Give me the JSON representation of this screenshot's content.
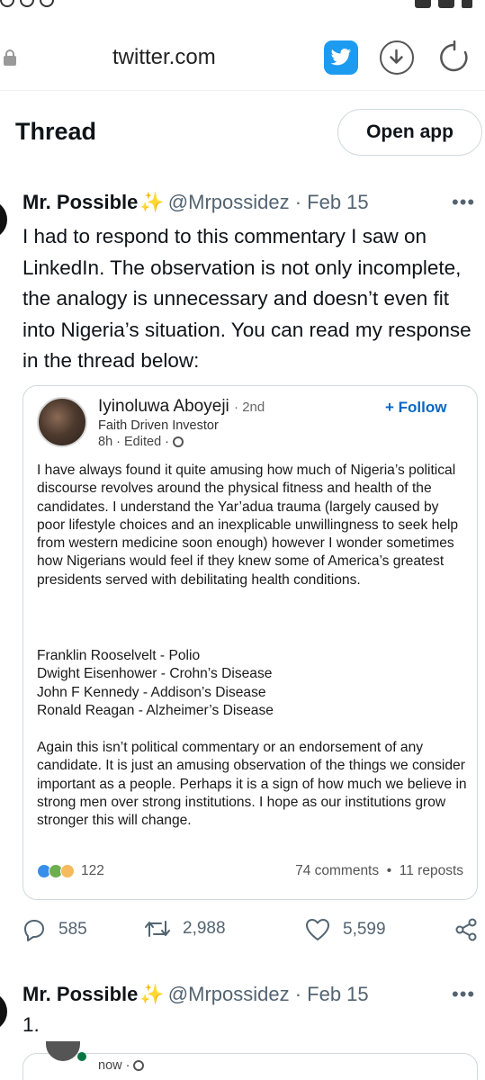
{
  "browser": {
    "url": "twitter.com"
  },
  "header": {
    "title": "Thread",
    "open_app_label": "Open app"
  },
  "tweet1": {
    "author": "Mr. Possible",
    "handle_date": "@Mrpossidez · Feb 15",
    "more": "•••",
    "text": "I had to respond to this commentary I saw on LinkedIn. The observation is not only incomplete, the analogy is unnecessary and doesn’t even fit into Nigeria’s situation. You can read my response in the thread below:",
    "card": {
      "name": "Iyinoluwa Aboyeji",
      "degree": "· 2nd",
      "headline": "Faith Driven Investor",
      "meta": "8h · Edited ·",
      "follow": "+ Follow",
      "paragraph1": "I have always found it quite amusing how much of Nigeria’s political discourse revolves around the physical fitness and health of the candidates. I understand the Yar’adua trauma (largely caused by poor lifestyle choices and an inexplicable unwillingness to seek help from western medicine soon enough) however I wonder sometimes how Nigerians would feel if they knew some of America’s greatest presidents served with debilitating health conditions.",
      "list": [
        "Franklin Rooselvelt - Polio",
        "Dwight Eisenhower - Crohn’s Disease",
        "John F Kennedy - Addison’s Disease",
        "Ronald Reagan - Alzheimer’s Disease"
      ],
      "paragraph2": "Again this isn’t political commentary or an endorsement of any candidate. It is just an amusing observation of the things we consider important as a people. Perhaps it is a sign of how much we believe in strong men over strong institutions. I hope as our institutions grow stronger this will change.",
      "reactions_count": "122",
      "stats": "74 comments  •  11 reposts"
    },
    "actions": {
      "replies": "585",
      "retweets": "2,988",
      "likes": "5,599"
    }
  },
  "tweet2": {
    "author": "Mr. Possible",
    "handle_date": "@Mrpossidez · Feb 15",
    "more": "•••",
    "text": "1.",
    "card_meta": "now ·"
  },
  "colors": {
    "twitter_blue": "#1d9bf0",
    "linkedin_blue": "#0a66c2",
    "muted": "#536471",
    "sparkle": "#ffb61e"
  },
  "icons": [
    "lock-icon",
    "twitter-bird-icon",
    "download-icon",
    "reload-icon",
    "sparkle-icon",
    "more-icon",
    "globe-icon",
    "reply-icon",
    "retweet-icon",
    "like-icon",
    "share-icon"
  ]
}
